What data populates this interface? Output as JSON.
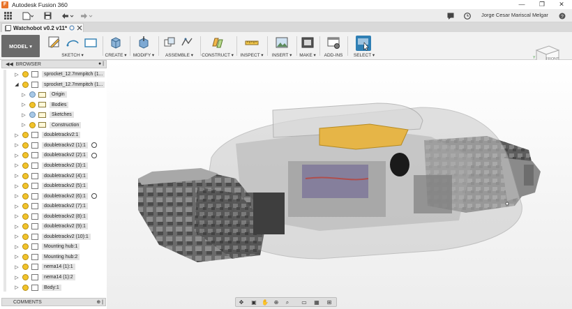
{
  "window": {
    "app_title": "Autodesk Fusion 360",
    "controls": {
      "minimize": "—",
      "maximize": "❐",
      "close": "✕"
    }
  },
  "quick_access": {
    "user_name": "Jorge Cesar Mariscal Melgar",
    "icons": [
      "grid-icon",
      "file-icon",
      "save-icon",
      "undo-icon",
      "redo-icon",
      "chat-icon",
      "clock-icon",
      "help-icon"
    ]
  },
  "document_tab": {
    "title": "Watchobot v0.2 v11*"
  },
  "ribbon": {
    "workspace": "MODEL",
    "groups": [
      {
        "id": "sketch",
        "label": "SKETCH ▾"
      },
      {
        "id": "create",
        "label": "CREATE ▾"
      },
      {
        "id": "modify",
        "label": "MODIFY ▾"
      },
      {
        "id": "assemble",
        "label": "ASSEMBLE ▾"
      },
      {
        "id": "construct",
        "label": "CONSTRUCT ▾"
      },
      {
        "id": "inspect",
        "label": "INSPECT ▾"
      },
      {
        "id": "insert",
        "label": "INSERT ▾"
      },
      {
        "id": "make",
        "label": "MAKE ▾"
      },
      {
        "id": "addins",
        "label": "ADD-INS"
      },
      {
        "id": "select",
        "label": "SELECT ▾"
      }
    ],
    "accent": "#2f7fb4"
  },
  "browser": {
    "title": "BROWSER",
    "items": [
      {
        "label": "sprocket_12.7mmpitch (1...",
        "indent": 0,
        "expanded": false,
        "kind": "component"
      },
      {
        "label": "sprocket_12.7mmpitch (1...",
        "indent": 0,
        "expanded": true,
        "kind": "component"
      },
      {
        "label": "Origin",
        "indent": 1,
        "expanded": false,
        "kind": "folder",
        "bulb": "blue"
      },
      {
        "label": "Bodies",
        "indent": 1,
        "expanded": false,
        "kind": "folder"
      },
      {
        "label": "Sketches",
        "indent": 1,
        "expanded": false,
        "kind": "folder",
        "bulb": "blue"
      },
      {
        "label": "Construction",
        "indent": 1,
        "expanded": false,
        "kind": "folder"
      },
      {
        "label": "doubletrackv2:1",
        "indent": 0,
        "expanded": false,
        "kind": "component"
      },
      {
        "label": "doubletrackv2 (1):1",
        "indent": 0,
        "expanded": false,
        "kind": "component",
        "radio": true
      },
      {
        "label": "doubletrackv2 (2):1",
        "indent": 0,
        "expanded": false,
        "kind": "component",
        "radio": true
      },
      {
        "label": "doubletrackv2 (3):1",
        "indent": 0,
        "expanded": false,
        "kind": "component"
      },
      {
        "label": "doubletrackv2 (4):1",
        "indent": 0,
        "expanded": false,
        "kind": "component"
      },
      {
        "label": "doubletrackv2 (5):1",
        "indent": 0,
        "expanded": false,
        "kind": "component"
      },
      {
        "label": "doubletrackv2 (6):1",
        "indent": 0,
        "expanded": false,
        "kind": "component",
        "radio": true
      },
      {
        "label": "doubletrackv2 (7):1",
        "indent": 0,
        "expanded": false,
        "kind": "component"
      },
      {
        "label": "doubletrackv2 (8):1",
        "indent": 0,
        "expanded": false,
        "kind": "component"
      },
      {
        "label": "doubletrackv2 (9):1",
        "indent": 0,
        "expanded": false,
        "kind": "component"
      },
      {
        "label": "doubletrackv2 (10):1",
        "indent": 0,
        "expanded": false,
        "kind": "component"
      },
      {
        "label": "Mounting hub:1",
        "indent": 0,
        "expanded": false,
        "kind": "component"
      },
      {
        "label": "Mounting hub:2",
        "indent": 0,
        "expanded": false,
        "kind": "component"
      },
      {
        "label": "nema14 (1):1",
        "indent": 0,
        "expanded": false,
        "kind": "component"
      },
      {
        "label": "nema14 (1):2",
        "indent": 0,
        "expanded": false,
        "kind": "component"
      },
      {
        "label": "Body:1",
        "indent": 0,
        "expanded": false,
        "kind": "component"
      }
    ]
  },
  "comments": {
    "title": "COMMENTS"
  },
  "viewcube": {
    "face": "FRONT"
  },
  "model": {
    "lid_color": "#e6b547",
    "shell_color": "#c9c9c9",
    "track_color": "#5a5a5a"
  }
}
